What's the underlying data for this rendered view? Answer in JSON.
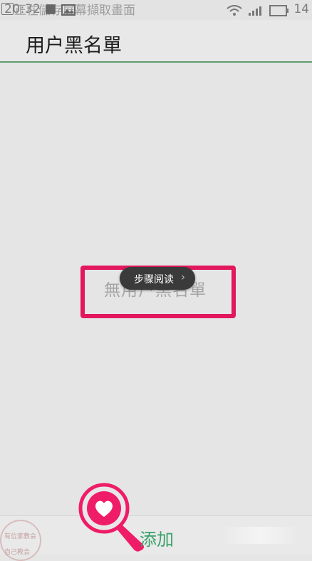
{
  "status_bar": {
    "time": "20:32",
    "ticker_text": "正在儲存屏幕擷取畫面",
    "battery_text": "14"
  },
  "header": {
    "title": "用户黑名單"
  },
  "main": {
    "empty_message": "無用户黑名單",
    "step_reading_pill": {
      "label": "步骤阅读",
      "chevron": "›"
    }
  },
  "bottom_bar": {
    "add_label": "添加",
    "add_icon": "heart-icon"
  },
  "stamp": {
    "line1": "有位家教会",
    "line2": "自己教会"
  },
  "colors": {
    "accent_green": "#39a26a",
    "highlight_red": "#e2175d",
    "pill_bg": "#3a3a3a"
  }
}
